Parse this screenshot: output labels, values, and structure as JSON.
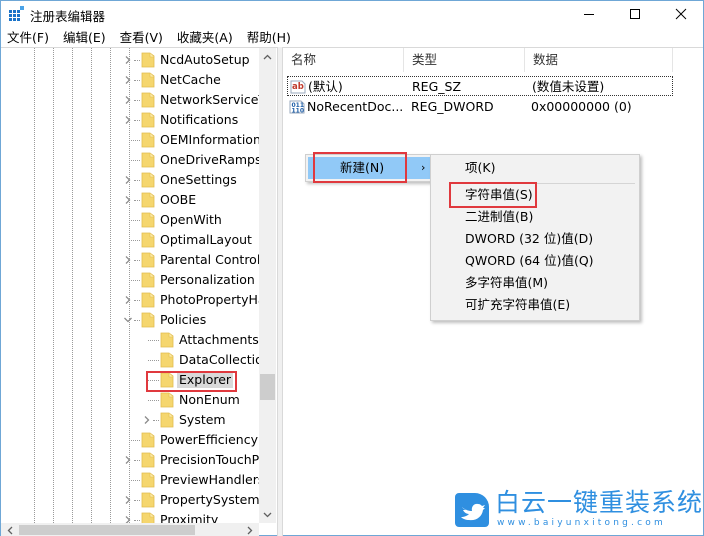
{
  "window": {
    "title": "注册表编辑器",
    "controls": {
      "minimize": "—",
      "maximize": "☐",
      "close": "✕"
    }
  },
  "menubar": {
    "items": [
      {
        "label": "文件(F)"
      },
      {
        "label": "编辑(E)"
      },
      {
        "label": "查看(V)"
      },
      {
        "label": "收藏夹(A)"
      },
      {
        "label": "帮助(H)"
      }
    ]
  },
  "tree": {
    "items": [
      {
        "label": "NcdAutoSetup",
        "level": 0,
        "expander": "collapsed"
      },
      {
        "label": "NetCache",
        "level": 0,
        "expander": "collapsed"
      },
      {
        "label": "NetworkServiceTr",
        "level": 0,
        "expander": "collapsed"
      },
      {
        "label": "Notifications",
        "level": 0,
        "expander": "collapsed"
      },
      {
        "label": "OEMInformation",
        "level": 0,
        "expander": "none"
      },
      {
        "label": "OneDriveRamps",
        "level": 0,
        "expander": "none"
      },
      {
        "label": "OneSettings",
        "level": 0,
        "expander": "collapsed"
      },
      {
        "label": "OOBE",
        "level": 0,
        "expander": "collapsed"
      },
      {
        "label": "OpenWith",
        "level": 0,
        "expander": "none"
      },
      {
        "label": "OptimalLayout",
        "level": 0,
        "expander": "none"
      },
      {
        "label": "Parental Controls",
        "level": 0,
        "expander": "collapsed"
      },
      {
        "label": "Personalization",
        "level": 0,
        "expander": "none"
      },
      {
        "label": "PhotoPropertyHa",
        "level": 0,
        "expander": "collapsed"
      },
      {
        "label": "Policies",
        "level": 0,
        "expander": "expanded"
      },
      {
        "label": "Attachments",
        "level": 1,
        "expander": "none"
      },
      {
        "label": "DataCollectior",
        "level": 1,
        "expander": "none"
      },
      {
        "label": "Explorer",
        "level": 1,
        "expander": "none",
        "selected": true
      },
      {
        "label": "NonEnum",
        "level": 1,
        "expander": "none"
      },
      {
        "label": "System",
        "level": 1,
        "expander": "collapsed"
      },
      {
        "label": "PowerEfficiencyDi",
        "level": 0,
        "expander": "none"
      },
      {
        "label": "PrecisionTouchPa",
        "level": 0,
        "expander": "collapsed"
      },
      {
        "label": "PreviewHandlers",
        "level": 0,
        "expander": "none"
      },
      {
        "label": "PropertySystem",
        "level": 0,
        "expander": "collapsed"
      },
      {
        "label": "Proximity",
        "level": 0,
        "expander": "collapsed"
      }
    ],
    "scrollbar": {
      "up": "⌃",
      "down": "⌄",
      "left": "‹",
      "right": "›"
    }
  },
  "values_list": {
    "columns": [
      "名称",
      "类型",
      "数据"
    ],
    "rows": [
      {
        "icon": "string-value-icon",
        "name": "(默认)",
        "type": "REG_SZ",
        "data": "(数值未设置)"
      },
      {
        "icon": "binary-value-icon",
        "name": "NoRecentDoc...",
        "type": "REG_DWORD",
        "data": "0x00000000 (0)"
      }
    ]
  },
  "context_menu": {
    "item": {
      "label": "新建(N)",
      "arrow": "›"
    },
    "submenu": [
      {
        "label": "项(K)"
      },
      {
        "label": "字符串值(S)",
        "highlighted": true
      },
      {
        "label": "二进制值(B)"
      },
      {
        "label": "DWORD (32 位)值(D)"
      },
      {
        "label": "QWORD (64 位)值(Q)"
      },
      {
        "label": "多字符串值(M)"
      },
      {
        "label": "可扩充字符串值(E)"
      }
    ]
  },
  "watermark": {
    "title": "白云一键重装系统",
    "url": "www.baiyunxitong.com"
  },
  "colors": {
    "highlight_box": "#e0393e",
    "menu_hover": "#91c9f7",
    "folder": "#f5d66e",
    "watermark": "#2f8fe0"
  }
}
